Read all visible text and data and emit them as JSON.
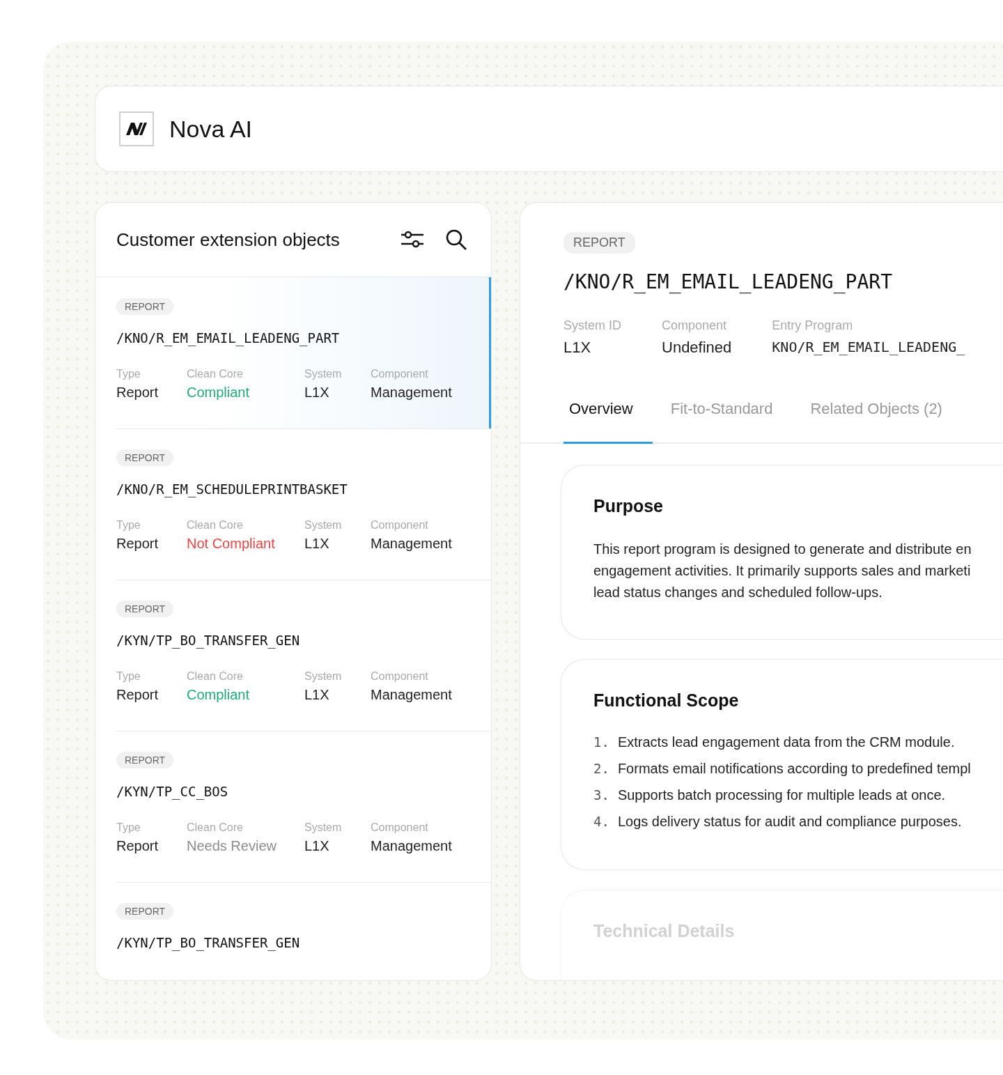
{
  "app": {
    "name": "Nova AI"
  },
  "list": {
    "title": "Customer extension objects",
    "items": [
      {
        "tag": "REPORT",
        "name": "/KNO/R_EM_EMAIL_LEADENG_PART",
        "selected": true,
        "fields": [
          {
            "label": "Type",
            "value": "Report",
            "color": "#222222"
          },
          {
            "label": "Clean Core",
            "value": "Compliant",
            "color": "#1fae77"
          },
          {
            "label": "System",
            "value": "L1X",
            "color": "#222222"
          },
          {
            "label": "Component",
            "value": "Management",
            "color": "#222222"
          }
        ]
      },
      {
        "tag": "REPORT",
        "name": "/KNO/R_EM_SCHEDULEPRINTBASKET",
        "selected": false,
        "fields": [
          {
            "label": "Type",
            "value": "Report",
            "color": "#222222"
          },
          {
            "label": "Clean Core",
            "value": "Not Compliant",
            "color": "#ee4444"
          },
          {
            "label": "System",
            "value": "L1X",
            "color": "#222222"
          },
          {
            "label": "Component",
            "value": "Management",
            "color": "#222222"
          }
        ]
      },
      {
        "tag": "REPORT",
        "name": "/KYN/TP_BO_TRANSFER_GEN",
        "selected": false,
        "fields": [
          {
            "label": "Type",
            "value": "Report",
            "color": "#222222"
          },
          {
            "label": "Clean Core",
            "value": "Compliant",
            "color": "#1fae77"
          },
          {
            "label": "System",
            "value": "L1X",
            "color": "#222222"
          },
          {
            "label": "Component",
            "value": "Management",
            "color": "#222222"
          }
        ]
      },
      {
        "tag": "REPORT",
        "name": "/KYN/TP_CC_BOS",
        "selected": false,
        "fields": [
          {
            "label": "Type",
            "value": "Report",
            "color": "#222222"
          },
          {
            "label": "Clean Core",
            "value": "Needs Review",
            "color": "#8c8c8c"
          },
          {
            "label": "System",
            "value": "L1X",
            "color": "#222222"
          },
          {
            "label": "Component",
            "value": "Management",
            "color": "#222222"
          }
        ]
      },
      {
        "tag": "REPORT",
        "name": "/KYN/TP_BO_TRANSFER_GEN",
        "selected": false
      }
    ]
  },
  "detail": {
    "tag": "REPORT",
    "name": "/KNO/R_EM_EMAIL_LEADENG_PART",
    "meta": [
      {
        "label": "System ID",
        "value": "L1X",
        "kind": "text"
      },
      {
        "label": "Component",
        "value": "Undefined",
        "kind": "text"
      },
      {
        "label": "Entry Program",
        "value": "KNO/R_EM_EMAIL_LEADENG_",
        "kind": "code"
      }
    ],
    "tabs": [
      {
        "label": "Overview",
        "selected": true
      },
      {
        "label": "Fit-to-Standard",
        "selected": false
      },
      {
        "label": "Related Objects (2)",
        "selected": false
      }
    ],
    "purpose": {
      "title": "Purpose",
      "lines": [
        "This report program is designed to generate and distribute en",
        "engagement activities. It primarily supports sales and marketi",
        "lead status changes and scheduled follow-ups."
      ]
    },
    "scope": {
      "title": "Functional Scope",
      "items": [
        {
          "number": "1.",
          "text": "Extracts lead engagement data from the CRM module."
        },
        {
          "number": "2.",
          "text": "Formats email notifications according to predefined templ"
        },
        {
          "number": "3.",
          "text": "Supports batch processing for multiple leads at once."
        },
        {
          "number": "4.",
          "text": "Logs delivery status for audit and compliance purposes."
        }
      ]
    },
    "technical": {
      "title": "Technical Details"
    }
  }
}
